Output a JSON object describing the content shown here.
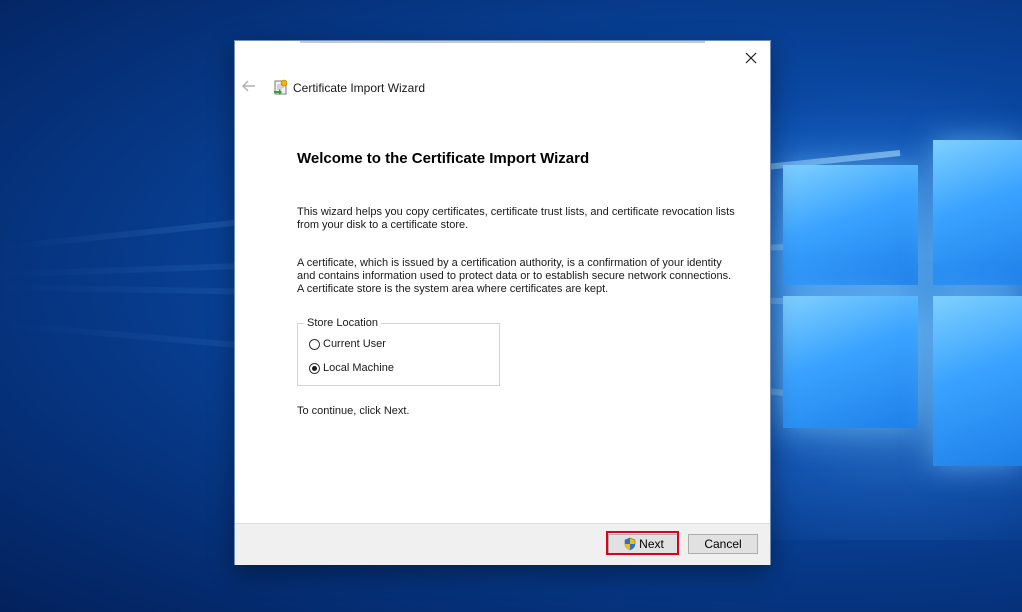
{
  "dialog": {
    "title": "Certificate Import Wizard",
    "heading": "Welcome to the Certificate Import Wizard",
    "paragraph1": "This wizard helps you copy certificates, certificate trust lists, and certificate revocation lists from your disk to a certificate store.",
    "paragraph2": "A certificate, which is issued by a certification authority, is a confirmation of your identity and contains information used to protect data or to establish secure network connections. A certificate store is the system area where certificates are kept.",
    "store_location": {
      "legend": "Store Location",
      "options": [
        {
          "label": "Current User",
          "checked": false
        },
        {
          "label": "Local Machine",
          "checked": true
        }
      ]
    },
    "continue_text": "To continue, click Next.",
    "buttons": {
      "next": "Next",
      "cancel": "Cancel"
    }
  },
  "colors": {
    "highlight": "#e0001b",
    "desktop": "#0a4aa6"
  }
}
